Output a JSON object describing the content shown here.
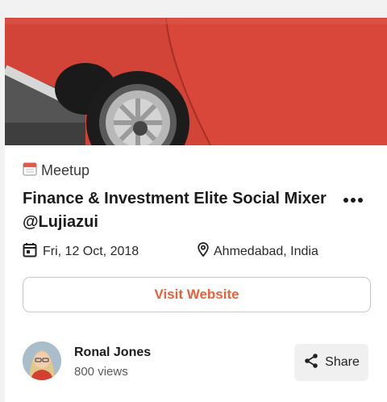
{
  "event": {
    "type_label": "Meetup",
    "title": "Finance & Investment Elite Social Mixer @Lujiazui",
    "date": "Fri, 12 Oct, 2018",
    "location": "Ahmedabad, India",
    "visit_label": "Visit Website"
  },
  "author": {
    "name": "Ronal Jones",
    "views": "800 views"
  },
  "actions": {
    "share_label": "Share"
  },
  "colors": {
    "accent": "#e8613a",
    "hero_car": "#d9473a"
  },
  "icons": {
    "type": "calendar-icon",
    "more": "more-horizontal-icon",
    "date": "calendar-icon",
    "location": "map-pin-icon",
    "share": "share-icon"
  }
}
